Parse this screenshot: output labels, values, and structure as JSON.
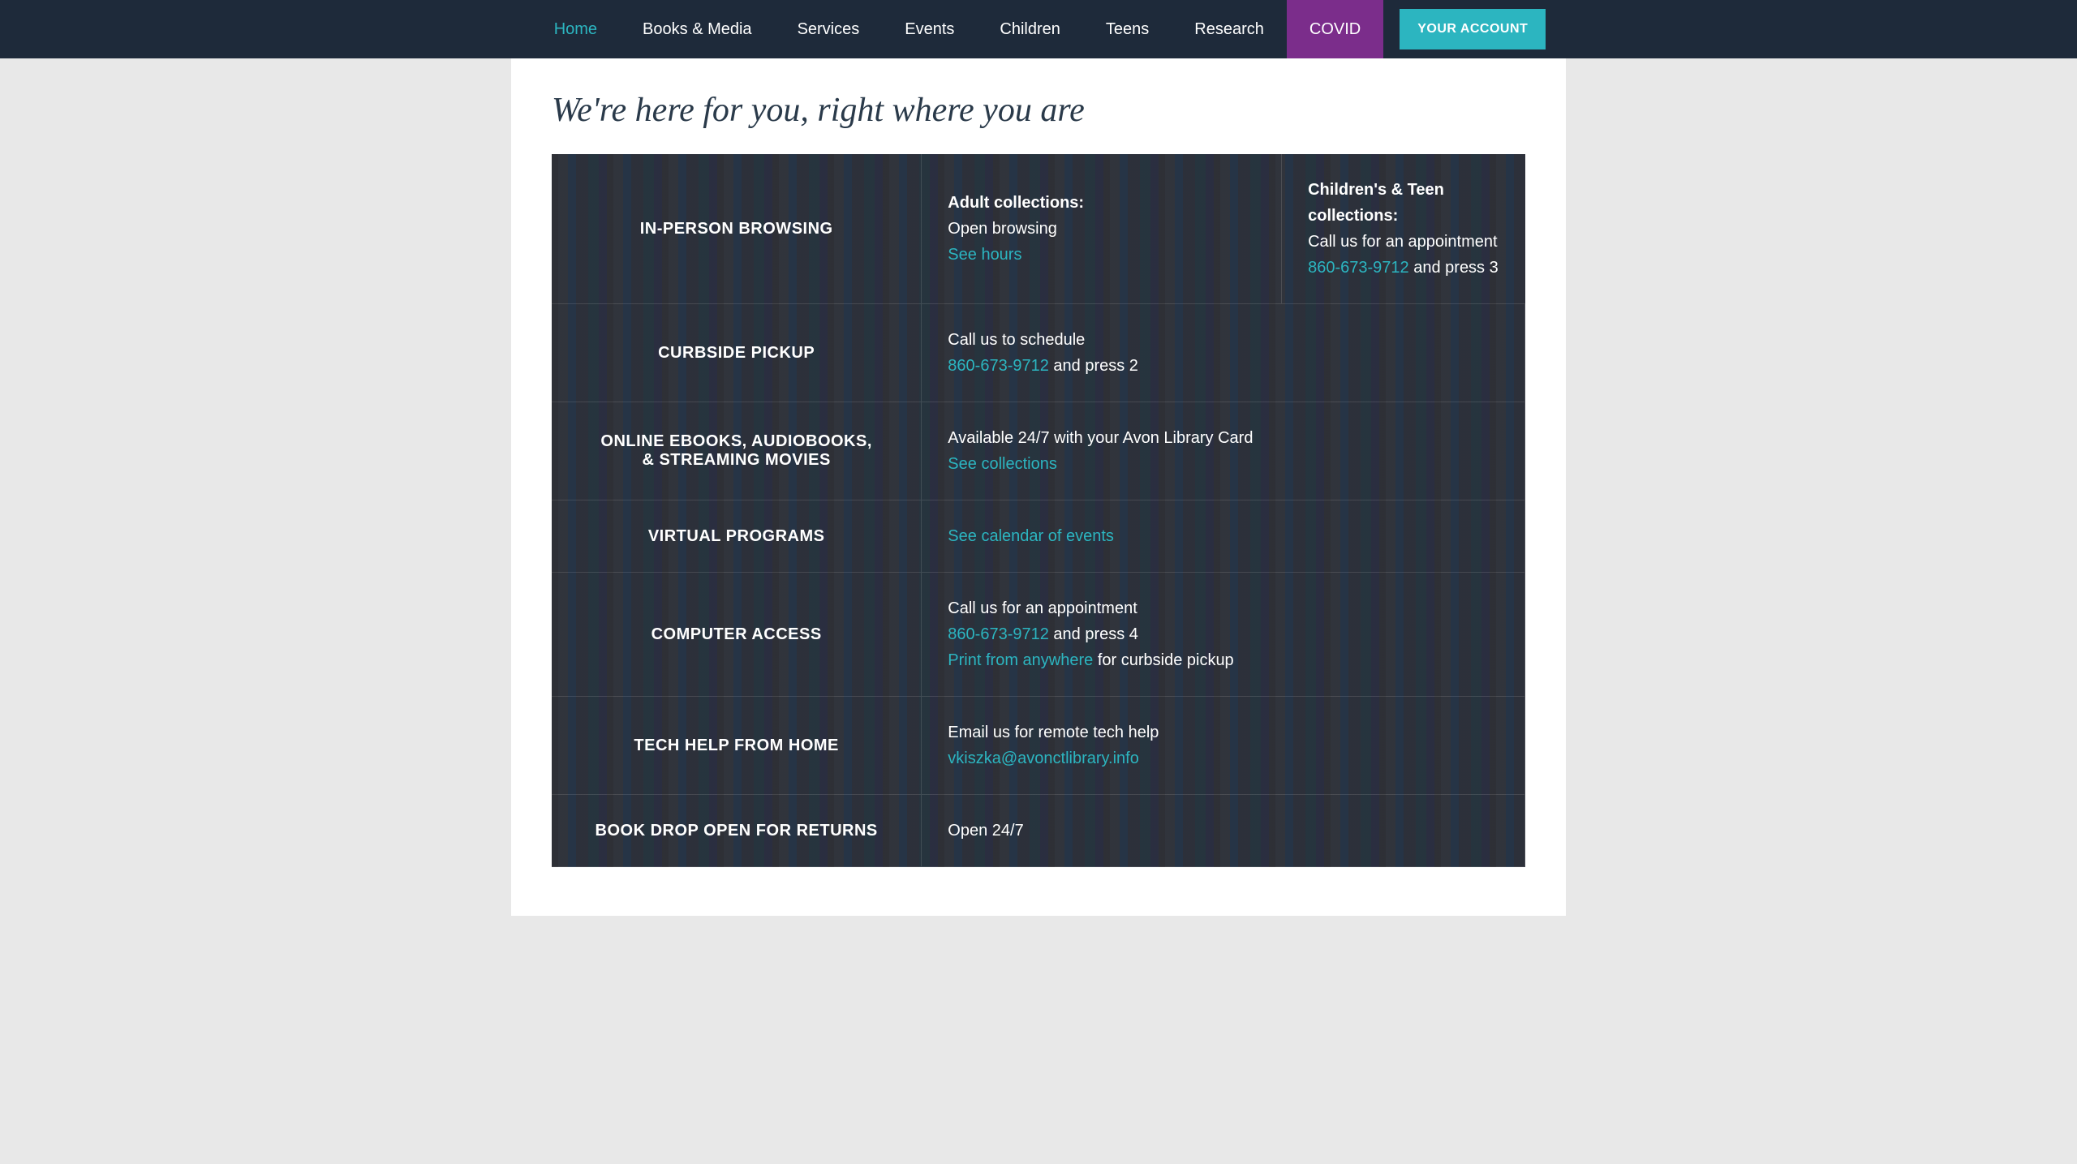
{
  "nav": {
    "items": [
      {
        "id": "home",
        "label": "Home",
        "active": true
      },
      {
        "id": "books-media",
        "label": "Books & Media",
        "active": false
      },
      {
        "id": "services",
        "label": "Services",
        "active": false
      },
      {
        "id": "events",
        "label": "Events",
        "active": false
      },
      {
        "id": "children",
        "label": "Children",
        "active": false
      },
      {
        "id": "teens",
        "label": "Teens",
        "active": false
      },
      {
        "id": "research",
        "label": "Research",
        "active": false
      },
      {
        "id": "covid",
        "label": "COVID",
        "active": false
      }
    ],
    "account_button": "YOUR ACCOUNT"
  },
  "page": {
    "title": "We're here for you, right where you are"
  },
  "table": {
    "rows": [
      {
        "id": "in-person",
        "label": "IN-PERSON BROWSING",
        "col2_bold": "Adult collections:",
        "col2_line1": "Open browsing",
        "col2_link": "See hours",
        "col3_bold": "Children's & Teen collections:",
        "col3_line1": "Call us for an appointment",
        "col3_link": "860-673-9712",
        "col3_suffix": " and press 3"
      },
      {
        "id": "curbside",
        "label": "CURBSIDE PICKUP",
        "col2_line1": "Call us to schedule",
        "col2_link": "860-673-9712",
        "col2_suffix": " and press 2",
        "col3_bold": "",
        "col3_line1": ""
      },
      {
        "id": "ebooks",
        "label": "ONLINE EBOOKS, AUDIOBOOKS,\n& STREAMING MOVIES",
        "col2_line1": "Available 24/7 with your Avon Library Card",
        "col2_link": "See collections",
        "col3_bold": "",
        "col3_line1": ""
      },
      {
        "id": "virtual",
        "label": "VIRTUAL PROGRAMS",
        "col2_link": "See calendar of events",
        "col3_bold": "",
        "col3_line1": ""
      },
      {
        "id": "computer",
        "label": "COMPUTER ACCESS",
        "col2_line1": "Call us for an appointment",
        "col2_link1": "860-673-9712",
        "col2_suffix1": " and press 4",
        "col2_link2": "Print from anywhere",
        "col2_suffix2": " for curbside pickup",
        "col3_bold": "",
        "col3_line1": ""
      },
      {
        "id": "tech-help",
        "label": "TECH HELP FROM HOME",
        "col2_line1": "Email us for remote tech help",
        "col2_link": "vkiszka@avonctlibrary.info",
        "col3_bold": "",
        "col3_line1": ""
      },
      {
        "id": "book-drop",
        "label": "BOOK DROP OPEN FOR RETURNS",
        "col2_line1": "Open 24/7",
        "col3_bold": "",
        "col3_line1": ""
      }
    ]
  }
}
